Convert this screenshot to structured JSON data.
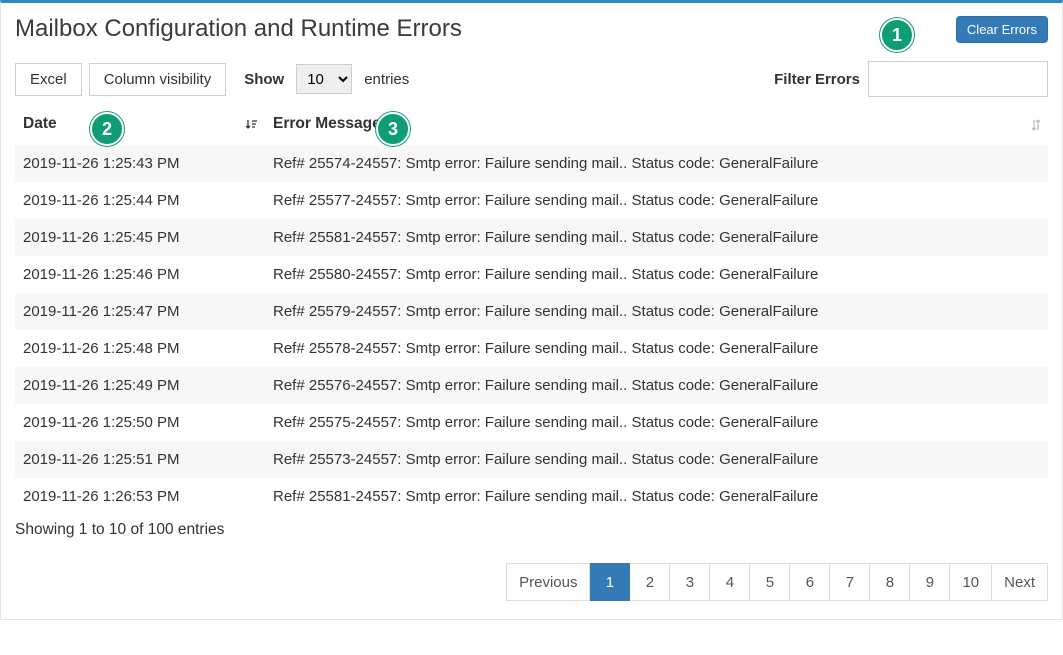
{
  "header": {
    "title": "Mailbox Configuration and Runtime Errors",
    "clear_label": "Clear Errors"
  },
  "callouts": {
    "c1": "1",
    "c2": "2",
    "c3": "3"
  },
  "toolbar": {
    "excel_label": "Excel",
    "colvis_label": "Column visibility",
    "show_label": "Show",
    "entries_label": "entries",
    "length_value": "10"
  },
  "filter": {
    "label": "Filter Errors",
    "value": ""
  },
  "columns": {
    "date": "Date",
    "error": "Error Message"
  },
  "rows": [
    {
      "date": "2019-11-26 1:25:43 PM",
      "msg": "Ref# 25574-24557: Smtp error: Failure sending mail.. Status code: GeneralFailure"
    },
    {
      "date": "2019-11-26 1:25:44 PM",
      "msg": "Ref# 25577-24557: Smtp error: Failure sending mail.. Status code: GeneralFailure"
    },
    {
      "date": "2019-11-26 1:25:45 PM",
      "msg": "Ref# 25581-24557: Smtp error: Failure sending mail.. Status code: GeneralFailure"
    },
    {
      "date": "2019-11-26 1:25:46 PM",
      "msg": "Ref# 25580-24557: Smtp error: Failure sending mail.. Status code: GeneralFailure"
    },
    {
      "date": "2019-11-26 1:25:47 PM",
      "msg": "Ref# 25579-24557: Smtp error: Failure sending mail.. Status code: GeneralFailure"
    },
    {
      "date": "2019-11-26 1:25:48 PM",
      "msg": "Ref# 25578-24557: Smtp error: Failure sending mail.. Status code: GeneralFailure"
    },
    {
      "date": "2019-11-26 1:25:49 PM",
      "msg": "Ref# 25576-24557: Smtp error: Failure sending mail.. Status code: GeneralFailure"
    },
    {
      "date": "2019-11-26 1:25:50 PM",
      "msg": "Ref# 25575-24557: Smtp error: Failure sending mail.. Status code: GeneralFailure"
    },
    {
      "date": "2019-11-26 1:25:51 PM",
      "msg": "Ref# 25573-24557: Smtp error: Failure sending mail.. Status code: GeneralFailure"
    },
    {
      "date": "2019-11-26 1:26:53 PM",
      "msg": "Ref# 25581-24557: Smtp error: Failure sending mail.. Status code: GeneralFailure"
    }
  ],
  "footer": {
    "showing": "Showing 1 to 10 of 100 entries"
  },
  "pager": {
    "prev": "Previous",
    "next": "Next",
    "pages": [
      "1",
      "2",
      "3",
      "4",
      "5",
      "6",
      "7",
      "8",
      "9",
      "10"
    ],
    "active": "1"
  }
}
